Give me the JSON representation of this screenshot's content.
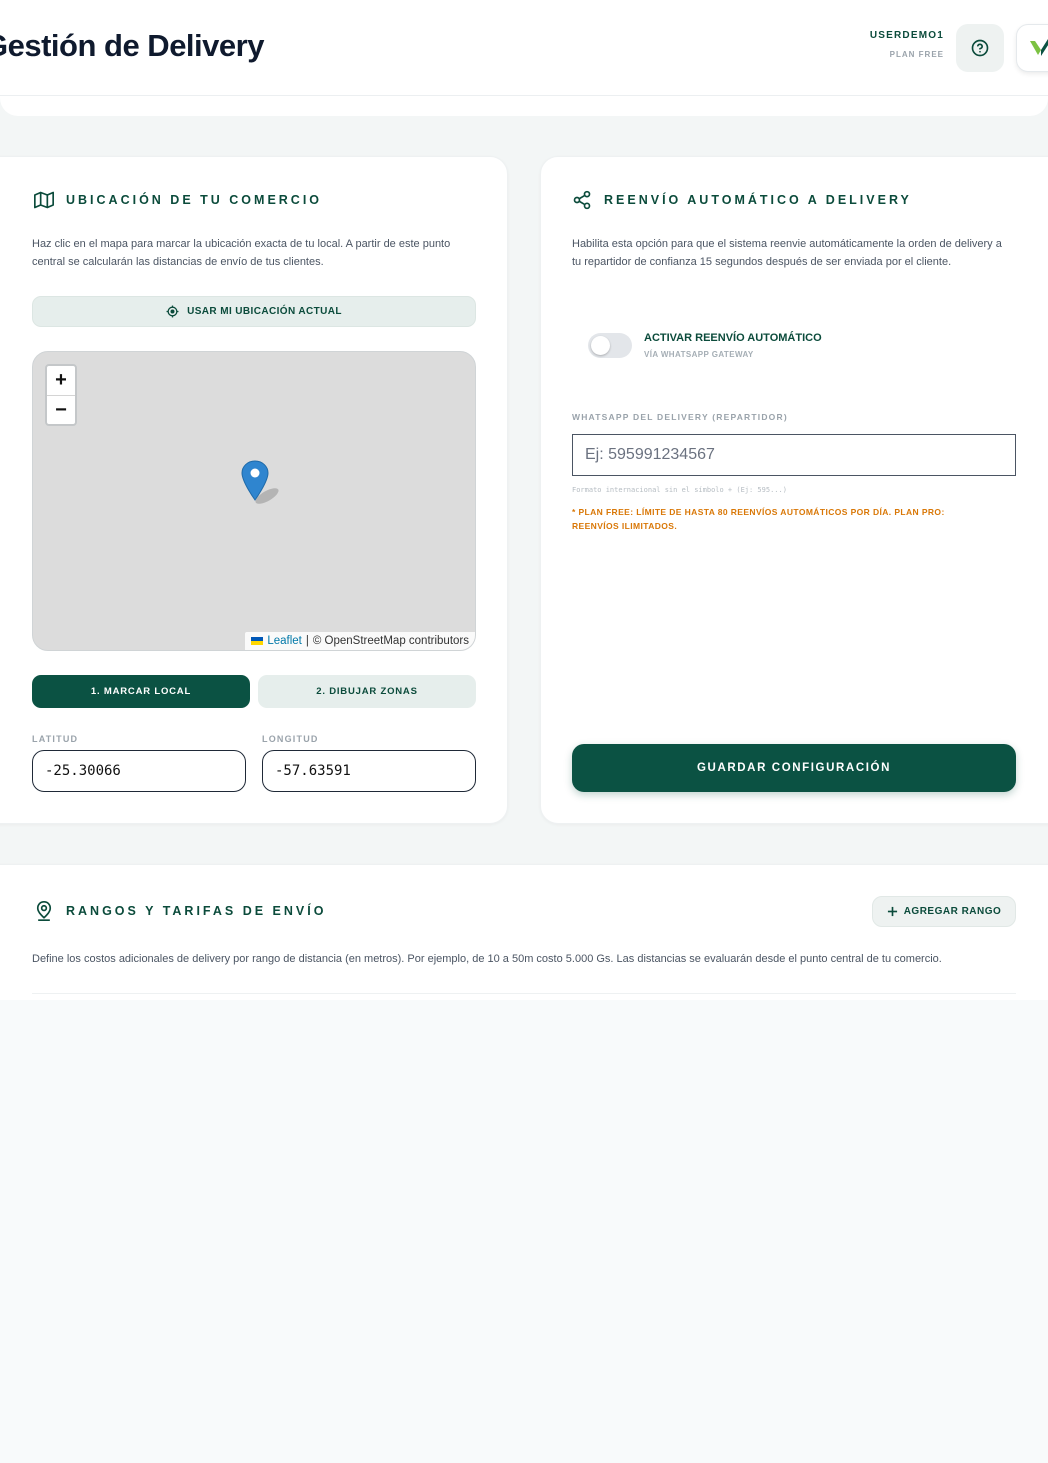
{
  "header": {
    "title": "Gestión de Delivery",
    "user_name": "USERDEMO1",
    "user_plan": "PLAN FREE",
    "help_icon": "help-circle-icon",
    "logo_icon": "brand-logo-icon"
  },
  "location_card": {
    "title": "UBICACIÓN DE TU COMERCIO",
    "icon": "map-icon",
    "description": "Haz clic en el mapa para marcar la ubicación exacta de tu local. A partir de este punto central se calcularán las distancias de envío de tus clientes.",
    "use_location_label": "USAR MI UBICACIÓN ACTUAL",
    "map": {
      "zoom_in": "+",
      "zoom_out": "−",
      "attribution_link": "Leaflet",
      "attribution_sep": "|",
      "attribution_text": "© OpenStreetMap contributors"
    },
    "mode_buttons": [
      "1. MARCAR LOCAL",
      "2. DIBUJAR ZONAS"
    ],
    "latitude_label": "LATITUD",
    "latitude_value": "-25.30066",
    "longitude_label": "LONGITUD",
    "longitude_value": "-57.63591"
  },
  "forward_card": {
    "title": "REENVÍO AUTOMÁTICO A DELIVERY",
    "icon": "share-icon",
    "description": "Habilita esta opción para que el sistema reenvie automáticamente la orden de delivery a tu repartidor de confianza 15 segundos después de ser enviada por el cliente.",
    "toggle_label": "ACTIVAR REENVÍO AUTOMÁTICO",
    "toggle_sub": "VÍA WHATSAPP GATEWAY",
    "toggle_on": false,
    "whatsapp_label": "WHATSAPP DEL DELIVERY (REPARTIDOR)",
    "whatsapp_placeholder": "Ej: 595991234567",
    "whatsapp_hint": "Formato internacional sin el símbolo + (Ej: 595...)",
    "plan_warning": "* PLAN FREE: LÍMITE DE HASTA 80 REENVÍOS AUTOMÁTICOS POR DÍA. PLAN PRO: REENVÍOS ILIMITADOS.",
    "save_label": "GUARDAR CONFIGURACIÓN"
  },
  "ranges_card": {
    "title": "RANGOS Y TARIFAS DE ENVÍO",
    "icon": "map-pin-icon",
    "add_label": "AGREGAR RANGO",
    "add_icon": "plus-icon",
    "description": "Define los costos adicionales de delivery por rango de distancia (en metros). Por ejemplo, de 10 a 50m costo 5.000 Gs. Las distancias se evaluarán desde el punto central de tu comercio."
  },
  "colors": {
    "brand": "#0b5243",
    "brand_text": "#0b4b3b",
    "warning": "#d97706"
  }
}
